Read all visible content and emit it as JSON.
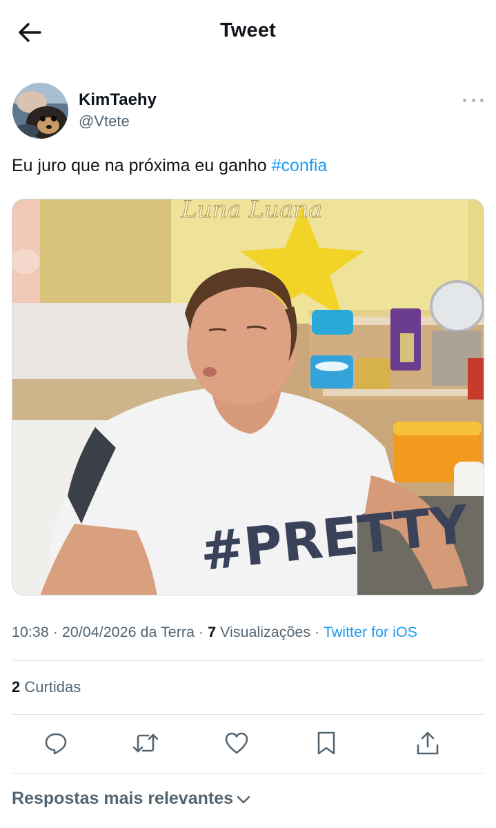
{
  "header": {
    "title": "Tweet",
    "back_icon": "arrow-left-icon"
  },
  "tweet": {
    "author": {
      "display_name": "KimTaehy",
      "handle": "@Vtete"
    },
    "text": "Eu juro que na próxima eu ganho ",
    "hashtag": "#confia",
    "media": {
      "shirt_text": "#PRETTY",
      "poster_text": "Luna Luana"
    },
    "meta": {
      "time": "10:38",
      "sep1": " · ",
      "date": "20/04/2026 da Terra",
      "sep2": " · ",
      "views_count": "7",
      "views_label": " Visualizações",
      "sep3": " · ",
      "source": "Twitter for iOS"
    },
    "likes": {
      "count": "2",
      "label": " Curtidas"
    },
    "actions": {
      "reply_icon": "reply-icon",
      "retweet_icon": "retweet-icon",
      "like_icon": "heart-icon",
      "bookmark_icon": "bookmark-icon",
      "share_icon": "share-icon"
    }
  },
  "replies": {
    "sort_label": "Respostas mais relevantes",
    "sort_icon": "chevron-down-icon"
  },
  "colors": {
    "accent": "#1d9bf0",
    "text_primary": "#0f1419",
    "text_secondary": "#536471",
    "divider": "#dfe4e8"
  }
}
